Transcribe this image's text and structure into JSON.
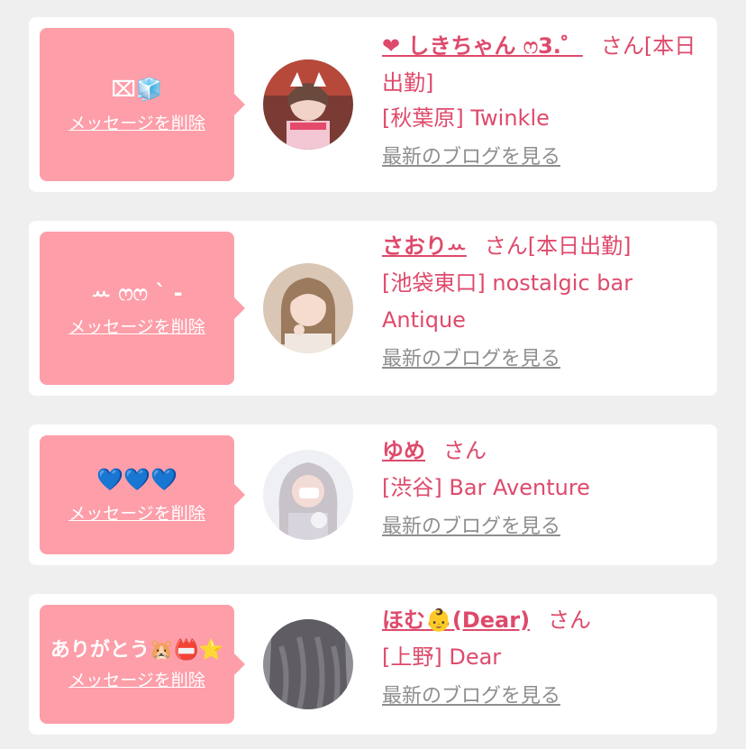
{
  "colors": {
    "bubble": "#fd9ea9",
    "accent": "#de4a6b",
    "muted": "#8e8e8e",
    "background": "#efefef"
  },
  "cards": [
    {
      "message": "⌧🧊",
      "delete_label": "メッセージを削除",
      "name": "❤ しきちゃん ෆ3.゜",
      "name_suffix": "さん[本日出勤]",
      "location": "[秋葉原] Twinkle",
      "location2": "",
      "blog_link": "最新のブログを見る",
      "avatar_icon": "avatar-photo-1"
    },
    {
      "message": "ꕀ ෆෆ ` -",
      "delete_label": "メッセージを削除",
      "name": "さおりꕀ",
      "name_suffix": "さん[本日出勤]",
      "location": "[池袋東口] nostalgic bar",
      "location2": "Antique",
      "blog_link": "最新のブログを見る",
      "avatar_icon": "avatar-photo-2"
    },
    {
      "message": "💙💙💙",
      "delete_label": "メッセージを削除",
      "name": "ゆめ",
      "name_suffix": "さん",
      "location": "[渋谷] Bar Aventure",
      "location2": "",
      "blog_link": "最新のブログを見る",
      "avatar_icon": "avatar-photo-3"
    },
    {
      "message": "ありがとう🐹📛⭐",
      "delete_label": "メッセージを削除",
      "name": "ほむ👶(Dear)",
      "name_suffix": "さん",
      "location": "[上野] Dear",
      "location2": "",
      "blog_link": "最新のブログを見る",
      "avatar_icon": "avatar-photo-4"
    }
  ]
}
